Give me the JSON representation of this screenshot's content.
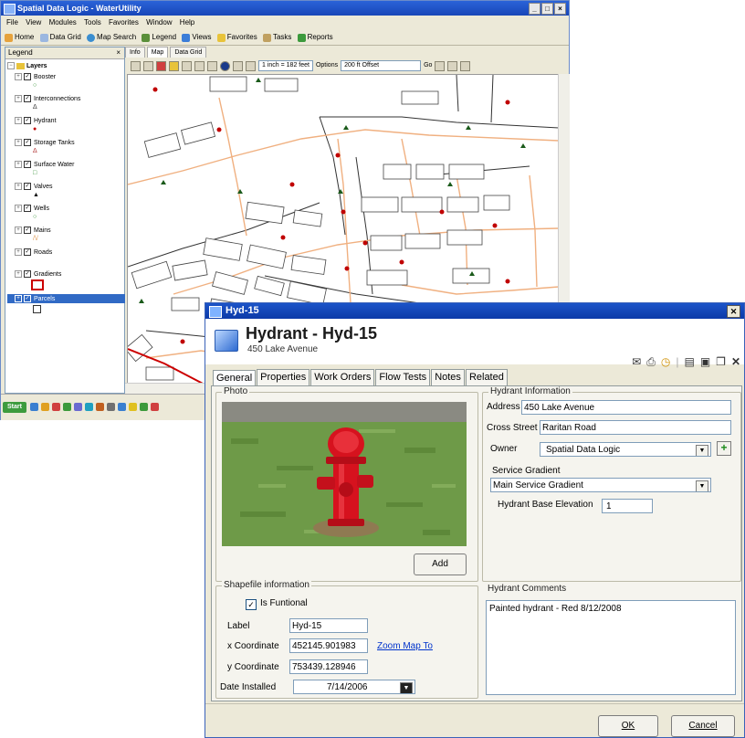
{
  "back_window": {
    "title": "Spatial Data Logic - WaterUtility",
    "menu": [
      "File",
      "View",
      "Modules",
      "Tools",
      "Favorites",
      "Window",
      "Help"
    ],
    "toolbar": [
      "Home",
      "Data Grid",
      "Map Search",
      "Legend",
      "Views",
      "Favorites",
      "Tasks",
      "Reports"
    ],
    "legend": {
      "title": "Legend",
      "root": "Layers",
      "layers": [
        "Booster",
        "Interconnections",
        "Hydrant",
        "Storage Tanks",
        "Surface Water",
        "Valves",
        "Wells",
        "Mains",
        "Roads",
        "Gradients",
        "Parcels"
      ],
      "selected": "Parcels"
    },
    "map_tabs": [
      "Info",
      "Map",
      "Data Grid"
    ],
    "scale": "1 inch = 182 feet",
    "options_label": "Options",
    "offset": "200 ft Offset",
    "go_label": "Go",
    "start_label": "Start"
  },
  "dialog": {
    "window_title": "Hyd-15",
    "heading": "Hydrant - Hyd-15",
    "subheading": "450 Lake Avenue",
    "tabs": [
      "General",
      "Properties",
      "Work Orders",
      "Flow Tests",
      "Notes",
      "Related"
    ],
    "active_tab": "General",
    "photo": {
      "group_label": "Photo",
      "add_button": "Add"
    },
    "shapefile": {
      "group_label": "Shapefile information",
      "is_functional_label": "Is Funtional",
      "is_functional": true,
      "label_label": "Label",
      "label_value": "Hyd-15",
      "x_label": "x Coordinate",
      "x_value": "452145.901983",
      "y_label": "y Coordinate",
      "y_value": "753439.128946",
      "zoom_link": "Zoom Map To",
      "date_label": "Date Installed",
      "date_value": "7/14/2006"
    },
    "info": {
      "group_label": "Hydrant Information",
      "address_label": "Address",
      "address_value": "450 Lake Avenue",
      "cross_label": "Cross Street",
      "cross_value": "Raritan Road",
      "owner_label": "Owner",
      "owner_value": "Spatial Data Logic",
      "gradient_label": "Service Gradient",
      "gradient_value": "Main Service Gradient",
      "elevation_label": "Hydrant Base Elevation",
      "elevation_value": "1"
    },
    "comments": {
      "group_label": "Hydrant Comments",
      "text": "Painted hydrant - Red 8/12/2008"
    },
    "ok_label": "OK",
    "cancel_label": "Cancel"
  }
}
